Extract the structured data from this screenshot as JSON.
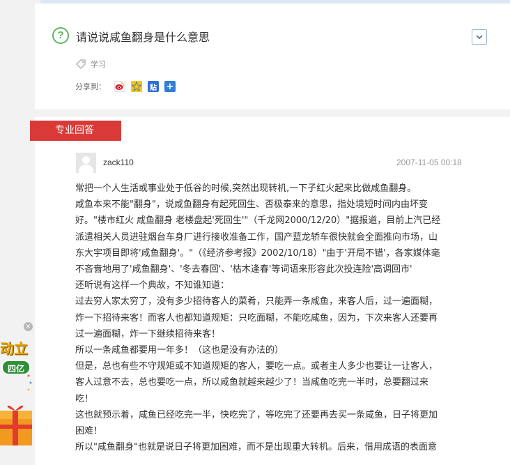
{
  "question": {
    "icon": "question-icon",
    "title": "请说说咸鱼翻身是什么意思",
    "collapse_glyph": "⌄",
    "tag_icon": "tag-icon",
    "tag": "学习",
    "share_label": "分享到：",
    "share_icons": [
      "weibo-icon",
      "qzone-icon",
      "tieba-icon",
      "more-share-icon"
    ]
  },
  "answer": {
    "section_label": "专业回答",
    "username": "zack110",
    "timestamp": "2007-11-05 00:18",
    "lines": [
      "常把一个人生活或事业处于低谷的时候,突然出现转机,一下子红火起来比做咸鱼翻身。",
      "咸鱼本来不能\"翻身\"，说咸鱼翻身有起死回生、否极泰来的意思，指处境短时间内由坏变",
      "好。\"楼市红火 咸鱼翻身 老楼盘起'死回生'\"（千龙网2000/12/20）\"据报道，目前上汽已经",
      "派遣相关人员进驻烟台车身厂进行接收准备工作，国产蓝龙轿车很快就会全面推向市场，山",
      "东大宇项目即将'咸鱼翻身'。\"（《经济参考报》2002/10/18）\"由于'开局不错'，各家媒体毫",
      "不吝啬地用了'咸鱼翻身'、'冬去春回'、'枯木逢春'等词语来形容此次投连险'高调回市'",
      "还听说有这样一个典故，不知谁知道：",
      "过去穷人家太穷了，没有多少招待客人的菜肴，只能弄一条咸鱼，来客人后，过一遍面糊，",
      "炸一下招待来客！而客人也都知道规矩：只吃面糊，不能吃咸鱼，因为，下次来客人还要再",
      "过一遍面糊，炸一下继续招待来客！",
      "所以一条咸鱼都要用一年多！（这也是没有办法的）",
      "但是，总也有些不守规矩或不知道规矩的客人，要吃一点。或者主人多少也要让一让客人，",
      "客人过意不去，总也要吃一点，所以咸鱼就越来越少了！当咸鱼吃完一半时，总要翻过来",
      "吃！",
      "这也就预示着，咸鱼已经吃完一半，快吃完了，等吃完了还要再去买一条咸鱼，日子将更加",
      "困难！",
      "所以\"咸鱼翻身\"也就是说日子将更加困难，而不是出现重大转机。后来，借用成语的表面意"
    ]
  },
  "ad": {
    "close_glyph": "×",
    "text_top": "动立",
    "badge": "四亿"
  },
  "colors": {
    "banner": "#d93a38",
    "question_icon": "#5bb85d",
    "link_blue": "#2f7fd6"
  }
}
